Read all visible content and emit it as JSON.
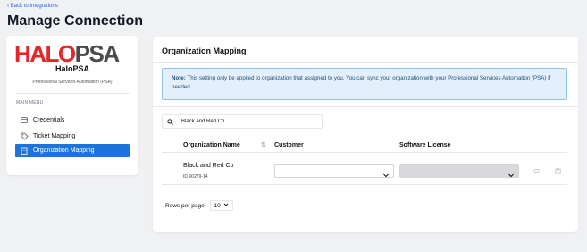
{
  "header": {
    "back_link": "‹ Back to Integrations",
    "title": "Manage Connection"
  },
  "sidebar": {
    "logo_halo": "HALO",
    "logo_psa": "PSA",
    "logo_subtitle": "HaloPSA",
    "description": "Professional Services Automation (PSA)",
    "menu_heading": "MAIN MENU",
    "items": [
      {
        "label": "Credentials",
        "icon": "credential-card-icon"
      },
      {
        "label": "Ticket Mapping",
        "icon": "tag-icon"
      },
      {
        "label": "Organization Mapping",
        "icon": "building-icon",
        "active": true
      }
    ]
  },
  "main": {
    "title": "Organization Mapping",
    "note_label": "Note:",
    "note_text": "This setting only be applied to organization that assigned to you. You can sync your organization with your Professional Services Automation (PSA) if needed.",
    "search_value": "Black and Red Co",
    "columns": [
      "Organization Name",
      "Customer",
      "Software License"
    ],
    "rows": [
      {
        "name": "Black and Red Co",
        "id": "ID 90279-14",
        "customer": "",
        "software_license": ""
      }
    ],
    "rows_per_page_label": "Rows per page:",
    "rows_per_page_value": "10"
  },
  "colors": {
    "accent": "#1e73d8",
    "brand_red": "#e5252a",
    "note_bg": "#e3f0fb"
  }
}
